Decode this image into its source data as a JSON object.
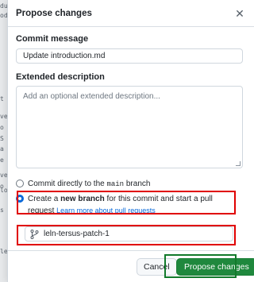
{
  "background": {
    "fragments": [
      "du",
      "od",
      "t",
      "ve",
      "o",
      "S",
      "a",
      "e",
      "ve",
      "o",
      "lo",
      "s",
      "lel"
    ]
  },
  "dialog": {
    "title": "Propose changes",
    "close_icon": "close-icon",
    "commit_message": {
      "label": "Commit message",
      "value": "Update introduction.md"
    },
    "extended_description": {
      "label": "Extended description",
      "placeholder": "Add an optional extended description..."
    },
    "options": {
      "direct": {
        "prefix": "Commit directly to the ",
        "branch": "main",
        "suffix": " branch",
        "checked": false
      },
      "new_branch": {
        "prefix": "Create a ",
        "bold": "new branch",
        "middle": " for this commit and start a pull request ",
        "link": "Learn more about pull requests",
        "checked": true
      }
    },
    "branch_name": {
      "icon": "git-branch-icon",
      "value": "leln-tersus-patch-1"
    },
    "buttons": {
      "cancel": "Cancel",
      "submit": "Propose changes"
    }
  },
  "colors": {
    "primary_green": "#1f883d",
    "accent_blue": "#0969da",
    "highlight_red": "#e00000"
  }
}
